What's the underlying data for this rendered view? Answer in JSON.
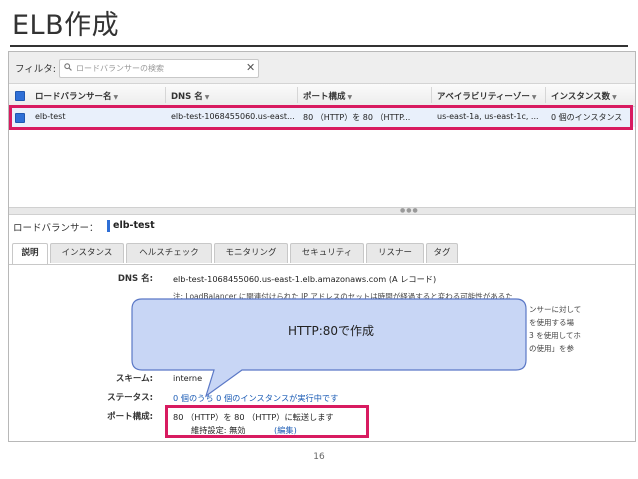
{
  "slide": {
    "title": "ELB作成",
    "page_number": "16"
  },
  "filter": {
    "label": "フィルタ:",
    "placeholder": "ロードバランサーの検索",
    "clear": "✕"
  },
  "table": {
    "headers": [
      "ロードバランサー名",
      "DNS 名",
      "ポート構成",
      "アベイラビリティーゾー",
      "インスタンス数"
    ],
    "row": {
      "name": "elb-test",
      "dns": "elb-test-1068455060.us-east...",
      "port": "80 （HTTP）を 80 （HTTP...",
      "az": "us-east-1a, us-east-1c, ...",
      "instances": "0 個のインスタンス"
    }
  },
  "detail": {
    "label": "ロードバランサー：",
    "name": "elb-test",
    "tabs": [
      "説明",
      "インスタンス",
      "ヘルスチェック",
      "モニタリング",
      "セキュリティ",
      "リスナー",
      "タグ"
    ],
    "dns_label": "DNS 名:",
    "dns_value": "elb-test-1068455060.us-east-1.elb.amazonaws.com (A レコード)",
    "note_lines": [
      "注: LoadBalancer に関連付けられた IP アドレスのセットは時間が経過すると変わる可能性があるた",
      "ンサーに対して",
      "を使用する場",
      "3 を使用してホ",
      "の使用」を参"
    ],
    "scheme_label": "スキーム:",
    "scheme_value": "interne",
    "status_label": "ステータス:",
    "status_value": "0 個のうち 0 個のインスタンスが実行中です",
    "port_label": "ポート構成:",
    "port_value": "80 （HTTP）を 80 （HTTP）に転送します",
    "stickiness": "維持設定: 無効",
    "edit": "(編集)"
  },
  "callout": {
    "text": "HTTP:80で作成"
  },
  "colors": {
    "highlight": "#d81b60",
    "callout_fill": "#c8d6f5",
    "callout_border": "#5b78c6",
    "accent": "#2f6fd6"
  }
}
